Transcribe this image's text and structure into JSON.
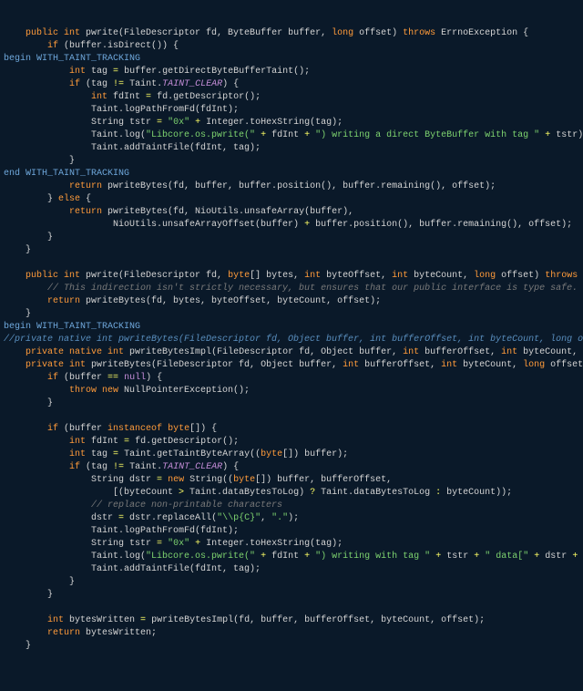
{
  "lines": {
    "l1": "    public int pwrite(FileDescriptor fd, ByteBuffer buffer, long offset) throws ErrnoException {",
    "l2": "        if (buffer.isDirect()) {",
    "l3": "begin WITH_TAINT_TRACKING",
    "l4": "            int tag = buffer.getDirectByteBufferTaint();",
    "l5": "            if (tag != Taint.TAINT_CLEAR) {",
    "l6": "                int fdInt = fd.getDescriptor();",
    "l7": "                Taint.logPathFromFd(fdInt);",
    "l8": "                String tstr = \"0x\" + Integer.toHexString(tag);",
    "l9": "                Taint.log(\"Libcore.os.pwrite(\" + fdInt + \") writing a direct ByteBuffer with tag \" + tstr);",
    "l10": "                Taint.addTaintFile(fdInt, tag);",
    "l11": "            }",
    "l12": "end WITH_TAINT_TRACKING",
    "l13": "            return pwriteBytes(fd, buffer, buffer.position(), buffer.remaining(), offset);",
    "l14": "        } else {",
    "l15": "            return pwriteBytes(fd, NioUtils.unsafeArray(buffer),",
    "l16": "                    NioUtils.unsafeArrayOffset(buffer) + buffer.position(), buffer.remaining(), offset);",
    "l17": "        }",
    "l18": "    }",
    "l19": "",
    "l20": "    public int pwrite(FileDescriptor fd, byte[] bytes, int byteOffset, int byteCount, long offset) throws ErrnoException {",
    "l21": "        // This indirection isn't strictly necessary, but ensures that our public interface is type safe.",
    "l22": "        return pwriteBytes(fd, bytes, byteOffset, byteCount, offset);",
    "l23": "    }",
    "l24": "begin WITH_TAINT_TRACKING",
    "l25": "//private native int pwriteBytes(FileDescriptor fd, Object buffer, int bufferOffset, int byteCount, long offset) throws",
    "l26": "    private native int pwriteBytesImpl(FileDescriptor fd, Object buffer, int bufferOffset, int byteCount, long offset) thro",
    "l27": "    private int pwriteBytes(FileDescriptor fd, Object buffer, int bufferOffset, int byteCount, long offset) throws ErrnoExc",
    "l28": "        if (buffer == null) {",
    "l29": "            throw new NullPointerException();",
    "l30": "        }",
    "l31": "",
    "l32": "        if (buffer instanceof byte[]) {",
    "l33": "            int fdInt = fd.getDescriptor();",
    "l34": "            int tag = Taint.getTaintByteArray((byte[]) buffer);",
    "l35": "            if (tag != Taint.TAINT_CLEAR) {",
    "l36": "                String dstr = new String((byte[]) buffer, bufferOffset,",
    "l37": "                    [(byteCount > Taint.dataBytesToLog) ? Taint.dataBytesToLog : byteCount));",
    "l38": "                // replace non-printable characters",
    "l39": "                dstr = dstr.replaceAll(\"\\\\p{C}\", \".\");",
    "l40": "                Taint.logPathFromFd(fdInt);",
    "l41": "                String tstr = \"0x\" + Integer.toHexString(tag);",
    "l42": "                Taint.log(\"Libcore.os.pwrite(\" + fdInt + \") writing with tag \" + tstr + \" data[\" + dstr + \"]\");",
    "l43": "                Taint.addTaintFile(fdInt, tag);",
    "l44": "            }",
    "l45": "        }",
    "l46": "",
    "l47": "        int bytesWritten = pwriteBytesImpl(fd, buffer, bufferOffset, byteCount, offset);",
    "l48": "        return bytesWritten;",
    "l49": "    }"
  },
  "strings": {
    "hex": "\"0x\"",
    "log1a": "\"Libcore.os.pwrite(\"",
    "log1b": "\") writing a direct ByteBuffer with tag \"",
    "log2b": "\") writing with tag \"",
    "data_open": "\" data[\"",
    "data_close": "\"]\"",
    "regex": "\"\\\\p{C}\"",
    "dot": "\".\""
  },
  "comments": {
    "indirection": "// This indirection isn't strictly necessary, but ensures that our public interface is type safe.",
    "replace": "// replace non-printable characters"
  },
  "constants": {
    "taint_clear": "TAINT_CLEAR"
  }
}
